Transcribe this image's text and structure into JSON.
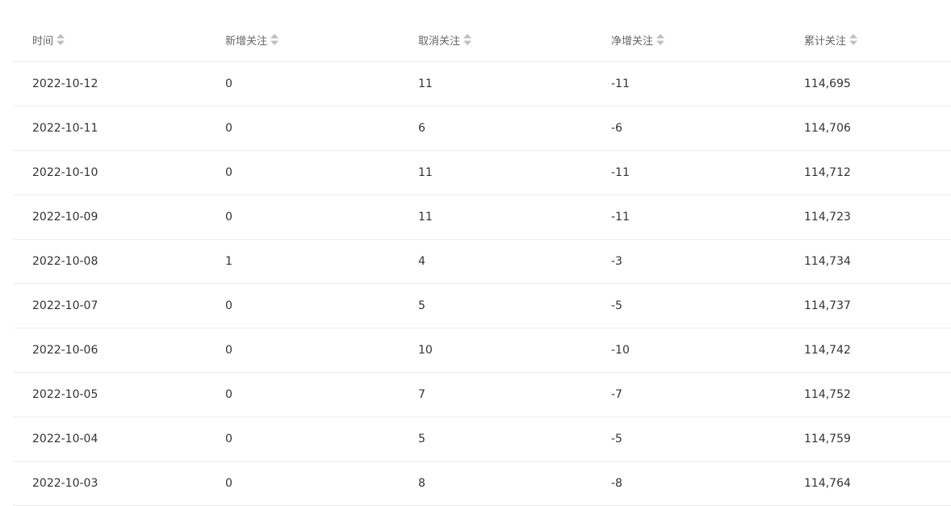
{
  "table": {
    "columns": [
      {
        "key": "date",
        "label": "时间"
      },
      {
        "key": "new",
        "label": "新增关注"
      },
      {
        "key": "cancel",
        "label": "取消关注"
      },
      {
        "key": "net",
        "label": "净增关注"
      },
      {
        "key": "total",
        "label": "累计关注"
      }
    ],
    "rows": [
      {
        "date": "2022-10-12",
        "new": "0",
        "cancel": "11",
        "net": "-11",
        "total": "114,695"
      },
      {
        "date": "2022-10-11",
        "new": "0",
        "cancel": "6",
        "net": "-6",
        "total": "114,706"
      },
      {
        "date": "2022-10-10",
        "new": "0",
        "cancel": "11",
        "net": "-11",
        "total": "114,712"
      },
      {
        "date": "2022-10-09",
        "new": "0",
        "cancel": "11",
        "net": "-11",
        "total": "114,723"
      },
      {
        "date": "2022-10-08",
        "new": "1",
        "cancel": "4",
        "net": "-3",
        "total": "114,734"
      },
      {
        "date": "2022-10-07",
        "new": "0",
        "cancel": "5",
        "net": "-5",
        "total": "114,737"
      },
      {
        "date": "2022-10-06",
        "new": "0",
        "cancel": "10",
        "net": "-10",
        "total": "114,742"
      },
      {
        "date": "2022-10-05",
        "new": "0",
        "cancel": "7",
        "net": "-7",
        "total": "114,752"
      },
      {
        "date": "2022-10-04",
        "new": "0",
        "cancel": "5",
        "net": "-5",
        "total": "114,759"
      },
      {
        "date": "2022-10-03",
        "new": "0",
        "cancel": "8",
        "net": "-8",
        "total": "114,764"
      }
    ]
  },
  "icons": {
    "sort": "sort-caret-icon"
  },
  "colors": {
    "sort_icon": "#bfbfbf",
    "border": "#ebedf0",
    "header_text": "#666666",
    "cell_text": "#333333"
  }
}
